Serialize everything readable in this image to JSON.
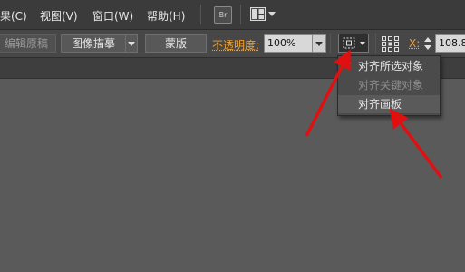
{
  "menubar": {
    "items": [
      {
        "label": "果(C)"
      },
      {
        "label": "视图(V)"
      },
      {
        "label": "窗口(W)"
      },
      {
        "label": "帮助(H)"
      }
    ],
    "bridge_label": "Br"
  },
  "toolbar": {
    "edit_original_label": "编辑原稿",
    "image_trace_label": "图像描摹",
    "mask_label": "蒙版",
    "opacity_label": "不透明度:",
    "opacity_value": "100%",
    "x_label": "X:",
    "x_value": "108.8"
  },
  "align_menu": {
    "items": [
      {
        "label": "对齐所选对象",
        "checked": true,
        "enabled": true
      },
      {
        "label": "对齐关键对象",
        "checked": false,
        "enabled": false
      },
      {
        "label": "对齐画板",
        "checked": false,
        "enabled": true
      }
    ]
  },
  "icons": [
    "bridge-icon",
    "arrange-documents-icon",
    "align-to-selection-icon",
    "transform-grid-icon",
    "checkmark-icon"
  ],
  "colors": {
    "menubar_bg": "#3b3b3b",
    "toolbar_bg": "#474747",
    "canvas_bg": "#5a5a5a",
    "orange_label": "#f0a030",
    "annotation_arrow": "#e01010"
  }
}
